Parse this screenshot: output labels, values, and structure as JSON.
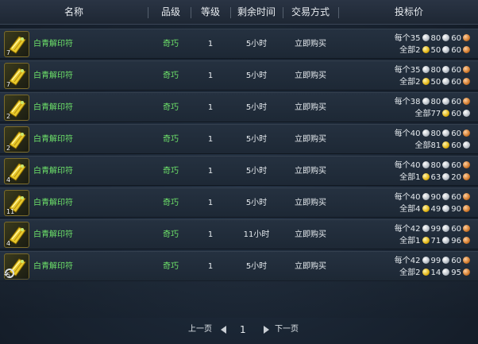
{
  "header": {
    "name": "名称",
    "quality": "品级",
    "level": "等级",
    "time_left": "剩余时间",
    "trade_type": "交易方式",
    "bid_price": "投标价"
  },
  "rows": [
    {
      "name": "白青解印符",
      "count": "7",
      "quality": "奇巧",
      "level": "1",
      "time": "5小时",
      "trade": "立即购买",
      "each_label": "每个",
      "each": [
        "35",
        "80",
        "60"
      ],
      "all_label": "全部",
      "all": [
        "2",
        "50",
        "60"
      ]
    },
    {
      "name": "白青解印符",
      "count": "7",
      "quality": "奇巧",
      "level": "1",
      "time": "5小时",
      "trade": "立即购买",
      "each_label": "每个",
      "each": [
        "35",
        "80",
        "60"
      ],
      "all_label": "全部",
      "all": [
        "2",
        "50",
        "60"
      ]
    },
    {
      "name": "白青解印符",
      "count": "2",
      "quality": "奇巧",
      "level": "1",
      "time": "5小时",
      "trade": "立即购买",
      "each_label": "每个",
      "each": [
        "38",
        "80",
        "60"
      ],
      "all_label": "全部",
      "all": [
        "77",
        "60",
        ""
      ]
    },
    {
      "name": "白青解印符",
      "count": "2",
      "quality": "奇巧",
      "level": "1",
      "time": "5小时",
      "trade": "立即购买",
      "each_label": "每个",
      "each": [
        "40",
        "80",
        "60"
      ],
      "all_label": "全部",
      "all": [
        "81",
        "60",
        ""
      ]
    },
    {
      "name": "白青解印符",
      "count": "4",
      "quality": "奇巧",
      "level": "1",
      "time": "5小时",
      "trade": "立即购买",
      "each_label": "每个",
      "each": [
        "40",
        "80",
        "60"
      ],
      "all_label": "全部",
      "all": [
        "1",
        "63",
        "20"
      ]
    },
    {
      "name": "白青解印符",
      "count": "11",
      "quality": "奇巧",
      "level": "1",
      "time": "5小时",
      "trade": "立即购买",
      "each_label": "每个",
      "each": [
        "40",
        "90",
        "60"
      ],
      "all_label": "全部",
      "all": [
        "4",
        "49",
        "90"
      ]
    },
    {
      "name": "白青解印符",
      "count": "4",
      "quality": "奇巧",
      "level": "1",
      "time": "11小时",
      "trade": "立即购买",
      "each_label": "每个",
      "each": [
        "42",
        "99",
        "60"
      ],
      "all_label": "全部",
      "all": [
        "1",
        "71",
        "96"
      ]
    },
    {
      "name": "白青解印符",
      "count": "5",
      "quality": "奇巧",
      "level": "1",
      "time": "5小时",
      "trade": "立即购买",
      "each_label": "每个",
      "each": [
        "42",
        "99",
        "60"
      ],
      "all_label": "全部",
      "all": [
        "2",
        "14",
        "95"
      ]
    }
  ],
  "pager": {
    "prev": "上一页",
    "page": "1",
    "next": "下一页"
  },
  "colors": {
    "item_name": "#6ee36a",
    "text": "#e6ebef"
  },
  "icons": {
    "item": "talisman-icon",
    "gold": "gold-coin-icon",
    "silver": "silver-coin-icon",
    "copper": "copper-coin-icon"
  }
}
